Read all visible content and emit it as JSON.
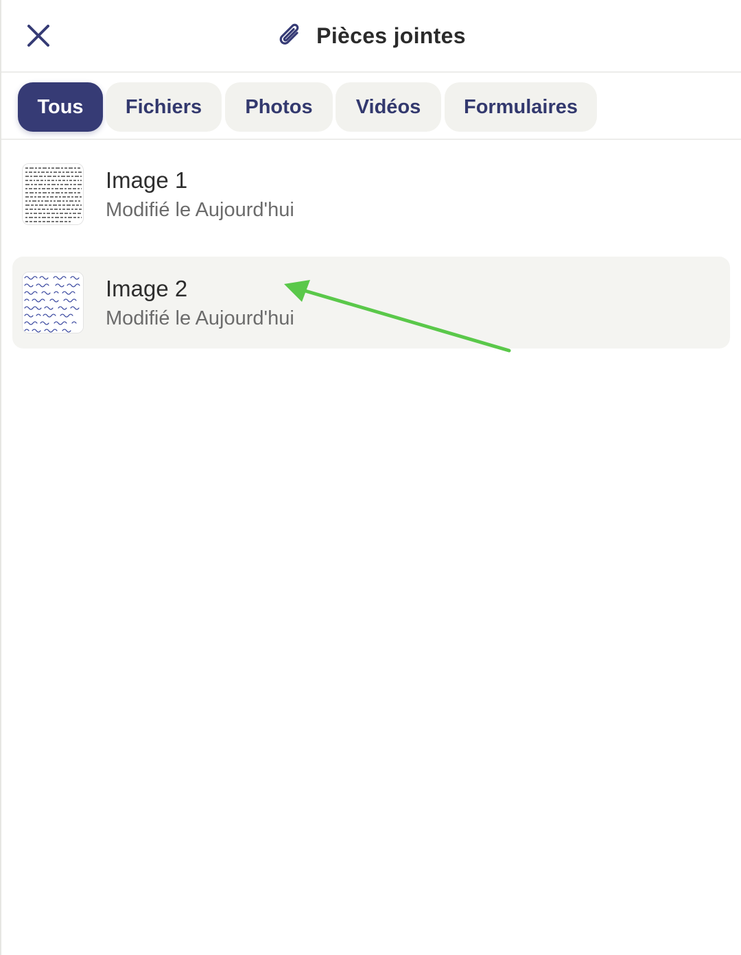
{
  "header": {
    "title": "Pièces jointes",
    "close_icon": "close-icon",
    "title_icon": "paperclip-icon"
  },
  "tabs": [
    {
      "label": "Tous",
      "active": true
    },
    {
      "label": "Fichiers",
      "active": false
    },
    {
      "label": "Photos",
      "active": false
    },
    {
      "label": "Vidéos",
      "active": false
    },
    {
      "label": "Formulaires",
      "active": false
    }
  ],
  "attachments": [
    {
      "title": "Image 1",
      "subtitle": "Modifié le Aujourd'hui",
      "selected": false
    },
    {
      "title": "Image 2",
      "subtitle": "Modifié le Aujourd'hui",
      "selected": true
    }
  ],
  "colors": {
    "accent": "#363b75",
    "tab_bg": "#f2f2ee",
    "selected_row_bg": "#f4f4f1",
    "arrow": "#5ac84a"
  }
}
